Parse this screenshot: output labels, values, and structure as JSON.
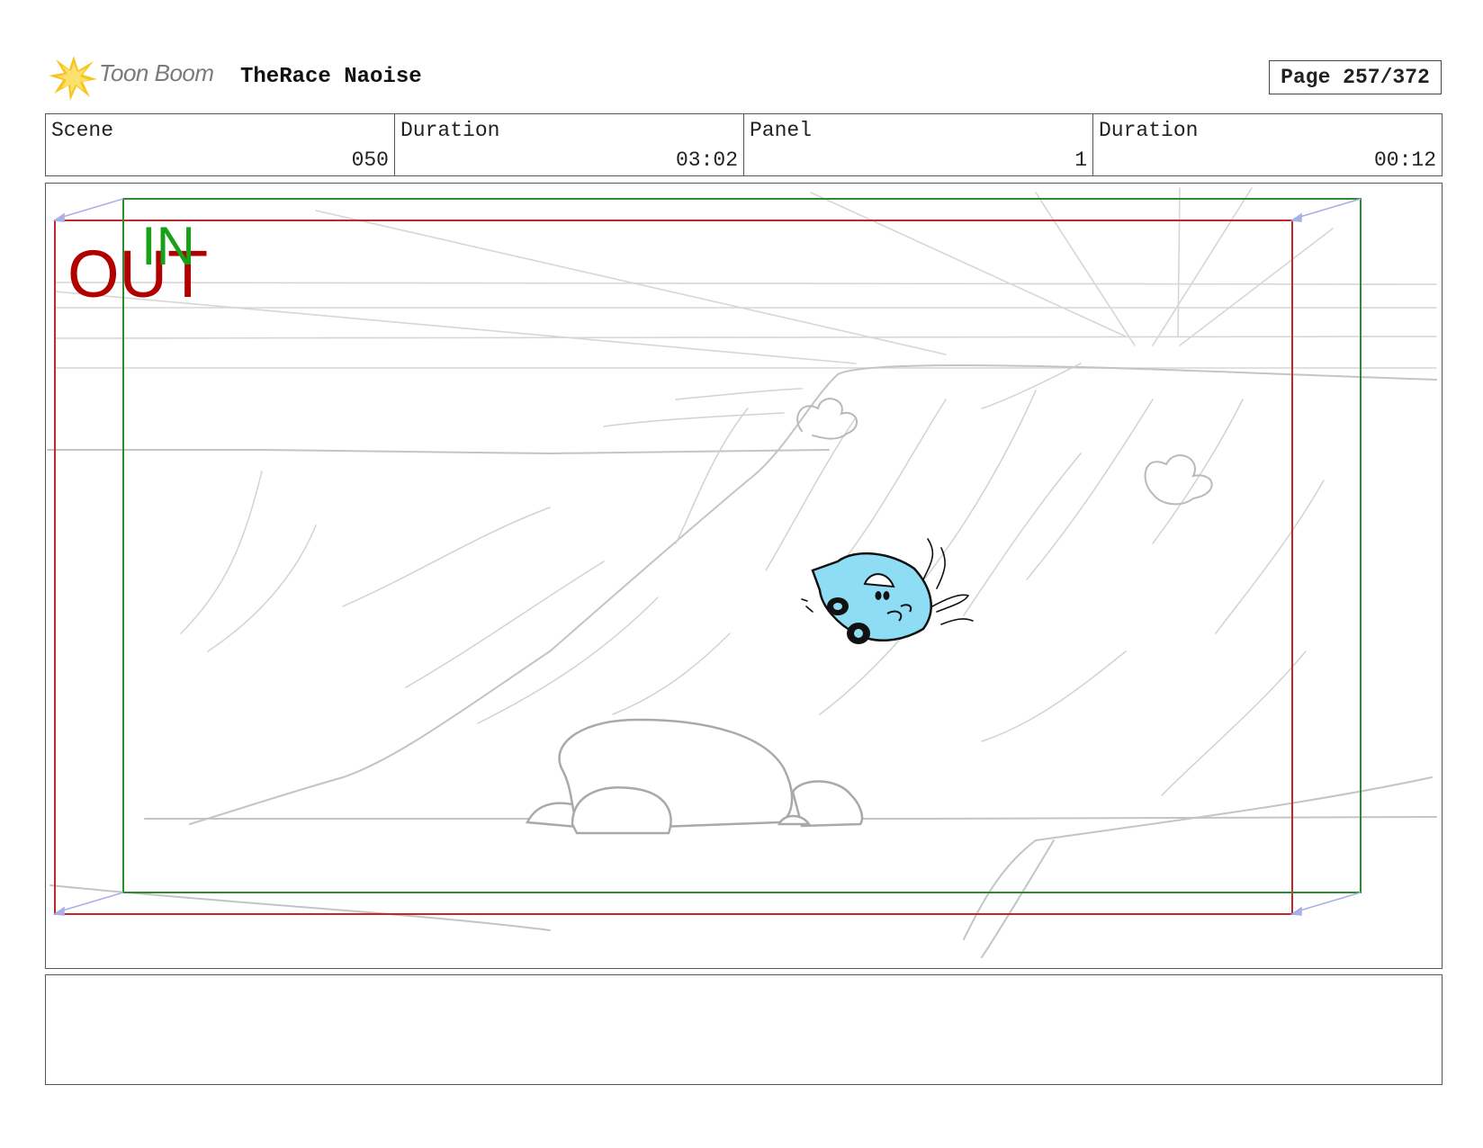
{
  "header": {
    "logo_text": "Toon Boom",
    "project_title": "TheRace Naoise",
    "page_label": "Page 257/372"
  },
  "info": [
    {
      "label": "Scene",
      "value": "050"
    },
    {
      "label": "Duration",
      "value": "03:02"
    },
    {
      "label": "Panel",
      "value": "1"
    },
    {
      "label": "Duration",
      "value": "00:12"
    }
  ],
  "panel": {
    "out_label": "OUT",
    "in_label": "IN",
    "colors": {
      "out_frame": "#c0282c",
      "in_frame": "#2e8b2e",
      "car_fill": "#8fdcf5",
      "sketch": "#bdbdbd"
    }
  },
  "notes": {
    "text": ""
  }
}
